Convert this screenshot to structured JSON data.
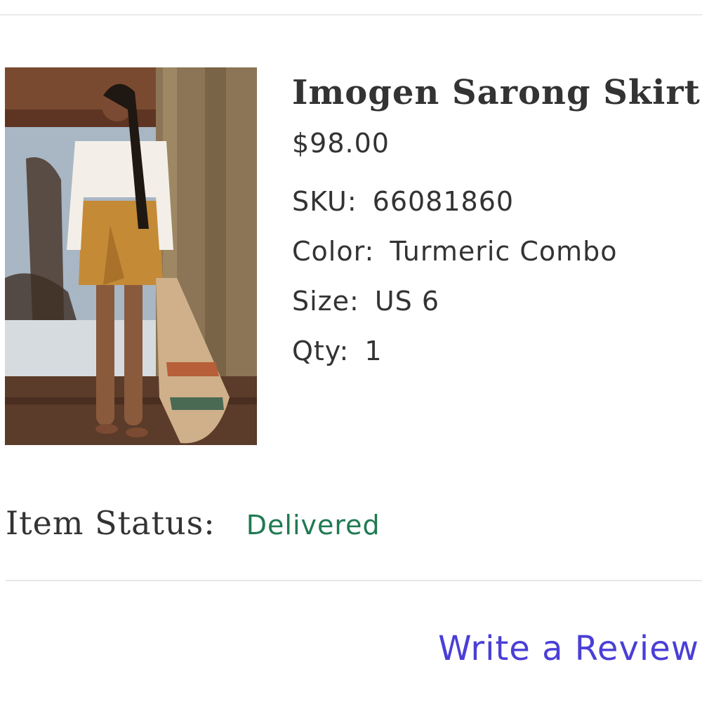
{
  "product": {
    "title": "Imogen Sarong Skirt",
    "price": "$98.00",
    "image_alt": "Model wearing Imogen Sarong Skirt",
    "attributes": [
      {
        "label": "SKU:",
        "value": "66081860"
      },
      {
        "label": "Color:",
        "value": "Turmeric Combo"
      },
      {
        "label": "Size:",
        "value": "US 6"
      },
      {
        "label": "Qty:",
        "value": "1"
      }
    ]
  },
  "status": {
    "label": "Item Status:",
    "value": "Delivered",
    "color": "#1f7a52"
  },
  "actions": {
    "review_label": "Write a Review",
    "link_color": "#4a3fd6"
  }
}
